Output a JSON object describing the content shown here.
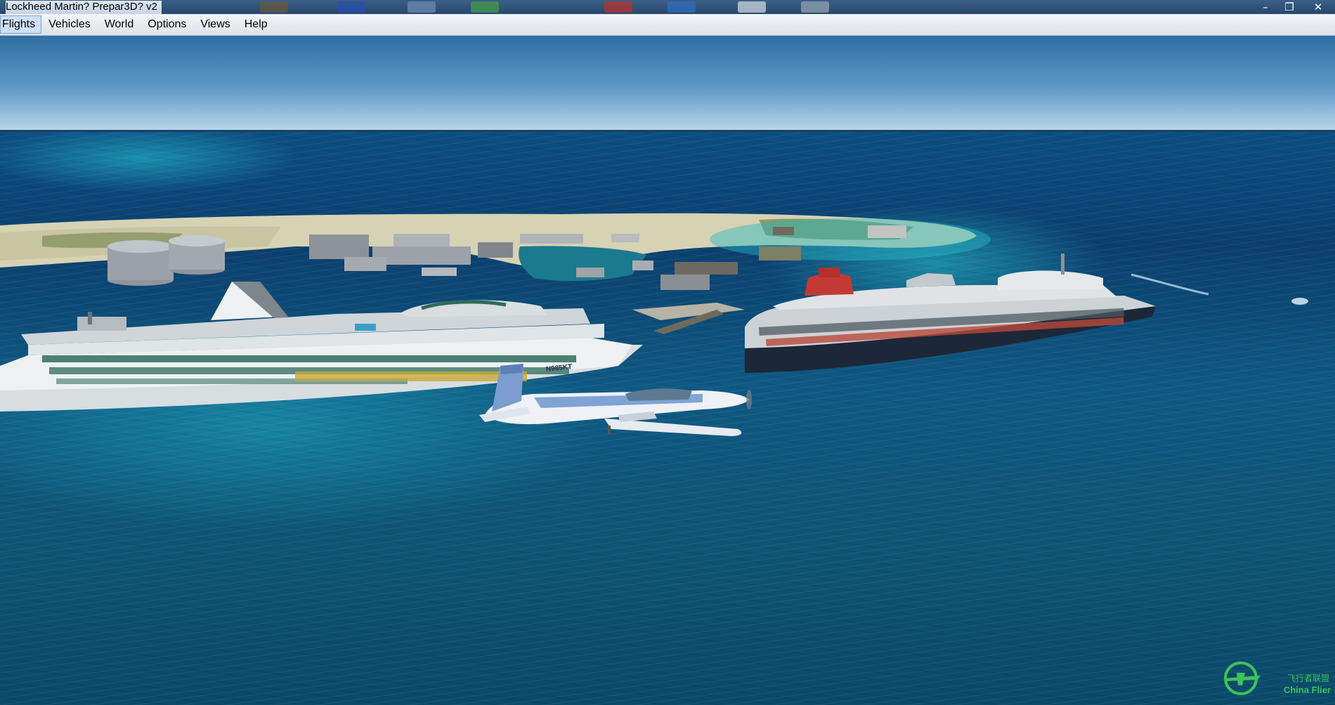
{
  "window": {
    "title": "Lockheed Martin? Prepar3D? v2",
    "controls": {
      "minimize": "minimize-icon",
      "maximize": "restore-icon",
      "close": "close-icon"
    }
  },
  "menubar": {
    "items": [
      {
        "label": "Flights",
        "active": true
      },
      {
        "label": "Vehicles"
      },
      {
        "label": "World"
      },
      {
        "label": "Options"
      },
      {
        "label": "Views"
      },
      {
        "label": "Help"
      }
    ]
  },
  "scene": {
    "aircraft_registration": "N985KT",
    "watermark": {
      "logo_text_cn": "飞行者联盟",
      "logo_text_en": "China Flier"
    }
  },
  "colors": {
    "titlebar": "#2f527a",
    "menubar": "#e6ebf1",
    "sky_top": "#2f6ea3",
    "ocean_deep": "#0b3f6e",
    "ocean_shallow": "#1fb0c0",
    "watermark_green": "#3ec25a"
  }
}
